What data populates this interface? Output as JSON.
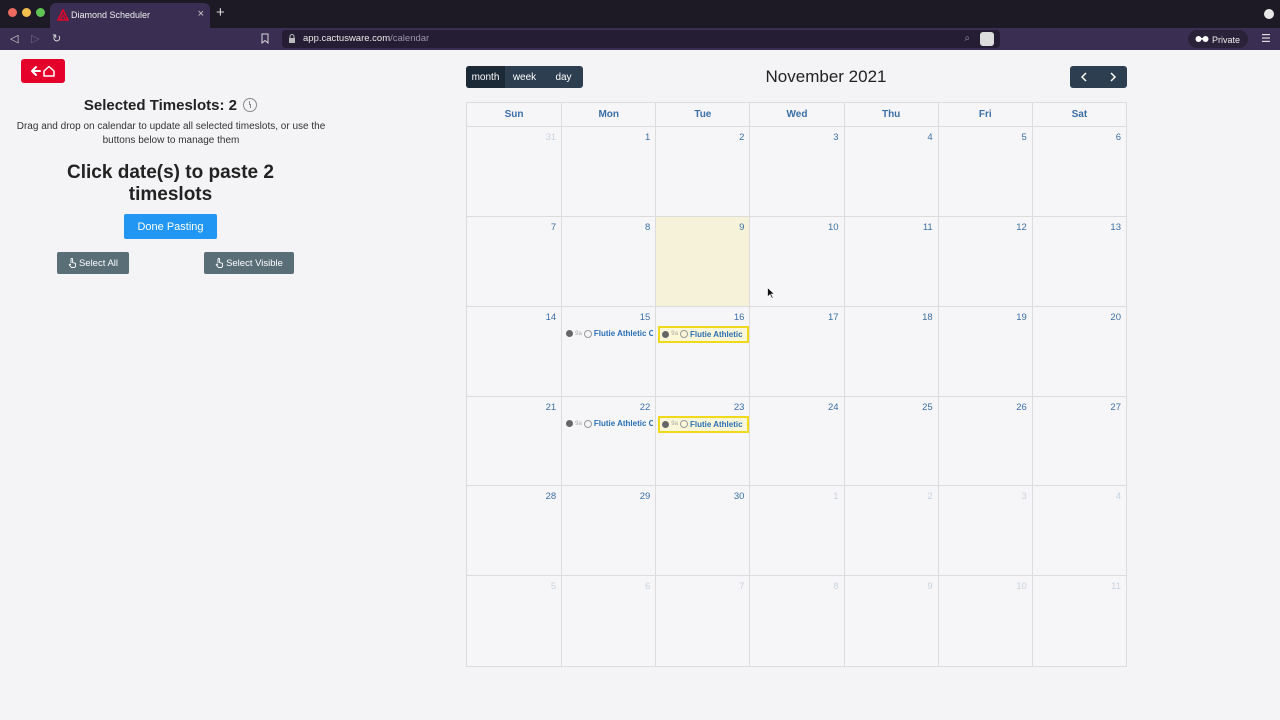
{
  "browser": {
    "tab_title": "Diamond Scheduler",
    "tab_close": "×",
    "new_tab": "+",
    "url_host": "app.cactusware.com",
    "url_path": "/calendar",
    "private_label": "Private"
  },
  "left_panel": {
    "selected_label": "Selected Timeslots: 2",
    "instructions": "Drag and drop on calendar to update all selected timeslots, or use the buttons below to manage them",
    "paste_title": "Click date(s) to paste 2 timeslots",
    "done_button": "Done Pasting",
    "select_all_button": "Select All",
    "select_visible_button": "Select Visible"
  },
  "calendar": {
    "views": [
      "month",
      "week",
      "day"
    ],
    "active_view": "month",
    "title": "November 2021",
    "days_of_week": [
      "Sun",
      "Mon",
      "Tue",
      "Wed",
      "Thu",
      "Fri",
      "Sat"
    ],
    "weeks": [
      [
        {
          "n": "31",
          "other": true
        },
        {
          "n": "1"
        },
        {
          "n": "2"
        },
        {
          "n": "3"
        },
        {
          "n": "4"
        },
        {
          "n": "5"
        },
        {
          "n": "6"
        }
      ],
      [
        {
          "n": "7"
        },
        {
          "n": "8"
        },
        {
          "n": "9",
          "today": true
        },
        {
          "n": "10"
        },
        {
          "n": "11"
        },
        {
          "n": "12"
        },
        {
          "n": "13"
        }
      ],
      [
        {
          "n": "14"
        },
        {
          "n": "15",
          "event": {
            "time": "9a",
            "title": "Flutie Athletic C",
            "selected": false
          }
        },
        {
          "n": "16",
          "event": {
            "time": "9a",
            "title": "Flutie Athletic",
            "selected": true
          }
        },
        {
          "n": "17"
        },
        {
          "n": "18"
        },
        {
          "n": "19"
        },
        {
          "n": "20"
        }
      ],
      [
        {
          "n": "21"
        },
        {
          "n": "22",
          "event": {
            "time": "9a",
            "title": "Flutie Athletic C",
            "selected": false
          }
        },
        {
          "n": "23",
          "event": {
            "time": "9a",
            "title": "Flutie Athletic",
            "selected": true
          }
        },
        {
          "n": "24"
        },
        {
          "n": "25"
        },
        {
          "n": "26"
        },
        {
          "n": "27"
        }
      ],
      [
        {
          "n": "28"
        },
        {
          "n": "29"
        },
        {
          "n": "30"
        },
        {
          "n": "1",
          "other": true
        },
        {
          "n": "2",
          "other": true
        },
        {
          "n": "3",
          "other": true
        },
        {
          "n": "4",
          "other": true
        }
      ],
      [
        {
          "n": "5",
          "other": true
        },
        {
          "n": "6",
          "other": true
        },
        {
          "n": "7",
          "other": true
        },
        {
          "n": "8",
          "other": true
        },
        {
          "n": "9",
          "other": true
        },
        {
          "n": "10",
          "other": true
        },
        {
          "n": "11",
          "other": true
        }
      ]
    ]
  },
  "colors": {
    "home_button": "#e4002b",
    "done_button": "#2196f3",
    "grey_button": "#5a6e78",
    "toolbar_group": "#2c3e50",
    "today_bg": "#f5f2d9",
    "selected_event_border": "#f0d81a",
    "day_number": "#3b6fa6"
  },
  "icons": {
    "home_button": "arrow-left-home-icon",
    "select_buttons": "hand-pointer-icon",
    "nav_prev": "chevron-left-icon",
    "nav_next": "chevron-right-icon",
    "selected_label": "clock-icon"
  }
}
